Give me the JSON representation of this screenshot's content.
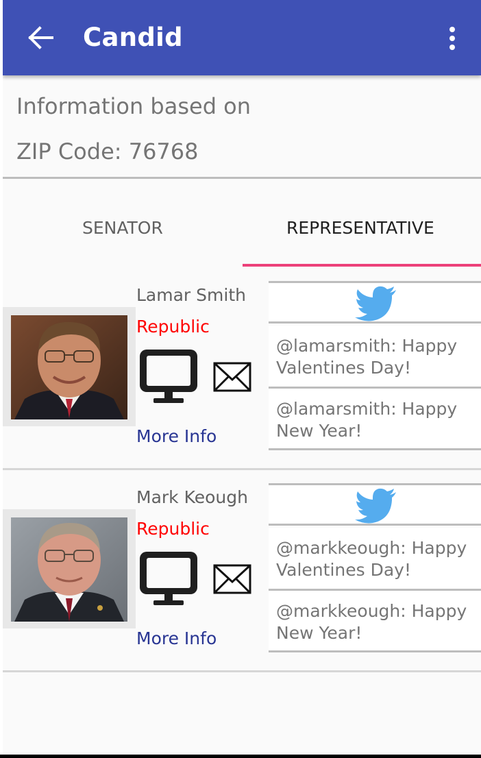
{
  "appbar": {
    "title": "Candid",
    "back_icon": "arrow-back-icon",
    "menu_icon": "more-vert-icon",
    "color": "#3f51b5"
  },
  "info": {
    "line1": "Information based on",
    "line2": "ZIP Code: 76768"
  },
  "tabs": [
    {
      "label": "SENATOR",
      "selected": false
    },
    {
      "label": "REPRESENTATIVE",
      "selected": true
    }
  ],
  "accent_color": "#ec407a",
  "representatives": [
    {
      "name": "Lamar Smith",
      "party": "Republic",
      "more_info": "More Info",
      "icons": [
        "website-monitor-icon",
        "email-envelope-icon",
        "twitter-bird-icon"
      ],
      "tweets": [
        {
          "line1": "@lamarsmith: Happy",
          "line2": "Valentines Day!"
        },
        {
          "line1": "@lamarsmith: Happy",
          "line2": "New Year!"
        }
      ]
    },
    {
      "name": "Mark Keough",
      "party": "Republic",
      "more_info": "More Info",
      "icons": [
        "website-monitor-icon",
        "email-envelope-icon",
        "twitter-bird-icon"
      ],
      "tweets": [
        {
          "line1": "@markkeough: Happy",
          "line2": "Valentines Day!"
        },
        {
          "line1": "@markkeough: Happy",
          "line2": "New Year!"
        }
      ]
    }
  ]
}
